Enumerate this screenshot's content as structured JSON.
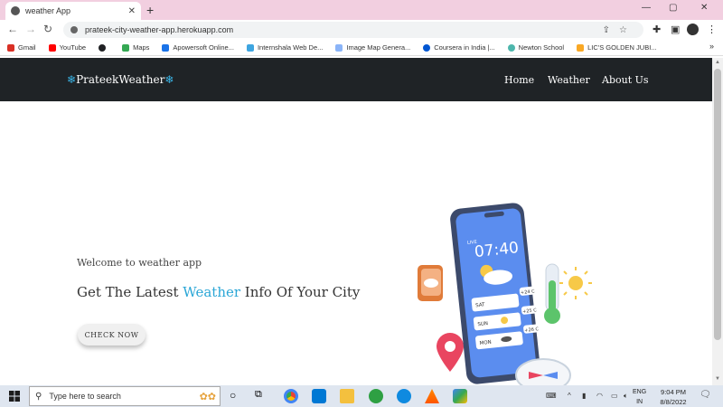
{
  "browser": {
    "tab_title": "weather App",
    "new_tab": "+",
    "url": "prateek-city-weather-app.herokuapp.com",
    "bookmarks": [
      {
        "label": "Gmail",
        "color": "#d93025"
      },
      {
        "label": "YouTube",
        "color": "#ff0000"
      },
      {
        "label": "",
        "color": "#202124"
      },
      {
        "label": "Maps",
        "color": "#34a853"
      },
      {
        "label": "Apowersoft Online...",
        "color": "#1a73e8"
      },
      {
        "label": "Internshala Web De...",
        "color": "#3ea5e0"
      },
      {
        "label": "Image Map Genera...",
        "color": "#8ab4f8"
      },
      {
        "label": "Coursera in India |...",
        "color": "#0056d2"
      },
      {
        "label": "Newton School",
        "color": "#4db6ac"
      },
      {
        "label": "LIC'S GOLDEN JUBI...",
        "color": "#f9a825"
      }
    ],
    "bookmarks_more": "»"
  },
  "site": {
    "brand": "PrateekWeather",
    "brand_icon": "❄",
    "nav": [
      "Home",
      "Weather",
      "About Us"
    ],
    "welcome": "Welcome to weather app",
    "headline_before": "Get The Latest ",
    "headline_accent": "Weather",
    "headline_after": " Info Of Your City",
    "cta": "CHECK NOW"
  },
  "phone": {
    "live": "LIVE",
    "time": "07:40",
    "days": [
      {
        "day": "SAT",
        "temp": "+24 C"
      },
      {
        "day": "SUN",
        "temp": "+25 C"
      },
      {
        "day": "MON",
        "temp": "+26 C"
      }
    ]
  },
  "taskbar": {
    "search_placeholder": "Type here to search",
    "lang_top": "ENG",
    "lang_bottom": "IN",
    "time": "9:04 PM",
    "date": "8/8/2022"
  },
  "colors": {
    "navbar": "#1f2326",
    "accent": "#2aa6d6",
    "tabstrip": "#f2cfe0",
    "phone_blue": "#5b8def"
  }
}
